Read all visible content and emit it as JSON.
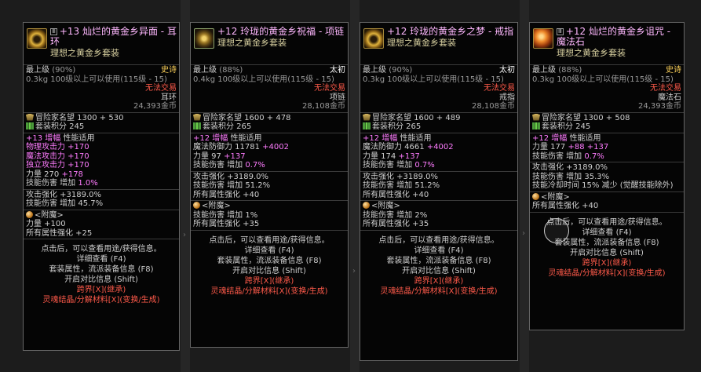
{
  "cards": [
    {
      "title": "灿烂的黄金乡异面 - 耳环",
      "plus": "+13",
      "set": "理想之黄金乡套装",
      "grade_label": "最上级",
      "grade_pct": "(90%)",
      "rarity": "史诗",
      "usage": "0.3kg  100级以上可以使用(115级 - 15)",
      "trade": "无法交易",
      "slot": "耳环",
      "price": "24,393金币",
      "fame": "冒险家名望 1300 + 530",
      "set_points": "套装积分 245",
      "amp_plus": "+13",
      "amp_word": "增幅",
      "amp_rest": " 性能适用",
      "lines_a": [
        {
          "t": "物理攻击力 +170",
          "c": "pink"
        },
        {
          "t": "魔法攻击力 +170",
          "c": "pink"
        },
        {
          "t": "独立攻击力 +170",
          "c": "pink"
        },
        {
          "t": "力量 270 ",
          "c": "",
          "x": "+178",
          "xc": "pink"
        },
        {
          "t": "技能伤害 增加 ",
          "c": "",
          "x": "1.0%",
          "xc": "pink"
        }
      ],
      "lines_b": [
        "攻击强化 +3189.0%",
        "技能伤害 增加 45.7%"
      ],
      "enchant_label": "<附魔>",
      "lines_c": [
        "力量 +100",
        "所有属性强化 +25"
      ]
    },
    {
      "title": "玲珑的黄金乡祝福 - 项链",
      "plus": "+12",
      "set": "理想之黄金乡套装",
      "grade_label": "最上级",
      "grade_pct": "(88%)",
      "rarity": "太初",
      "usage": "0.4kg  100级以上可以使用(115级 - 15)",
      "trade": "无法交易",
      "slot": "项链",
      "price": "28,108金币",
      "fame": "冒险家名望 1600 + 478",
      "set_points": "套装积分 265",
      "amp_plus": "+12",
      "amp_word": "增幅",
      "amp_rest": " 性能适用",
      "lines_a": [
        {
          "t": "魔法防御力 11781 ",
          "c": "",
          "x": "+4002",
          "xc": "pink"
        },
        {
          "t": "力量 97 ",
          "c": "",
          "x": "+137",
          "xc": "pink"
        },
        {
          "t": "技能伤害 增加 ",
          "c": "",
          "x": "0.7%",
          "xc": "pink"
        }
      ],
      "lines_b": [
        "攻击强化 +3189.0%",
        "技能伤害 增加 51.2%",
        "所有属性强化 +40"
      ],
      "enchant_label": "<附魔>",
      "lines_c": [
        "技能伤害 增加 1%",
        "所有属性强化 +35"
      ]
    },
    {
      "title": "玲珑的黄金乡之梦 - 戒指",
      "plus": "+12",
      "set": "理想之黄金乡套装",
      "grade_label": "最上级",
      "grade_pct": "(90%)",
      "rarity": "太初",
      "usage": "0.3kg  100级以上可以使用(115级 - 15)",
      "trade": "无法交易",
      "slot": "戒指",
      "price": "28,108金币",
      "fame": "冒险家名望 1600 + 489",
      "set_points": "套装积分 265",
      "amp_plus": "+12",
      "amp_word": "增幅",
      "amp_rest": " 性能适用",
      "lines_a": [
        {
          "t": "魔法防御力 4661 ",
          "c": "",
          "x": "+4002",
          "xc": "pink"
        },
        {
          "t": "力量 174 ",
          "c": "",
          "x": "+137",
          "xc": "pink"
        },
        {
          "t": "技能伤害 增加 ",
          "c": "",
          "x": "0.7%",
          "xc": "pink"
        }
      ],
      "lines_b": [
        "攻击强化 +3189.0%",
        "技能伤害 增加 51.2%",
        "所有属性强化 +40"
      ],
      "enchant_label": "<附魔>",
      "lines_c": [
        "技能伤害 增加 2%",
        "所有属性强化 +35"
      ]
    },
    {
      "title": "灿烂的黄金乡诅咒 - 魔法石",
      "plus": "+12",
      "set": "理想之黄金乡套装",
      "grade_label": "最上级",
      "grade_pct": "(88%)",
      "rarity": "史诗",
      "usage": "0.3kg  100级以上可以使用(115级 - 15)",
      "trade": "无法交易",
      "slot": "魔法石",
      "price": "24,393金币",
      "fame": "冒险家名望 1300 + 508",
      "set_points": "套装积分 245",
      "amp_plus": "+12",
      "amp_word": "增幅",
      "amp_rest": " 性能适用",
      "lines_a": [
        {
          "t": "力量 177 ",
          "c": "",
          "x": "+88 +137",
          "xc": "pink"
        },
        {
          "t": "技能伤害 增加 ",
          "c": "",
          "x": "0.7%",
          "xc": "pink"
        }
      ],
      "lines_b": [
        "攻击强化 +3189.0%",
        "技能伤害 增加 35.3%",
        "技能冷却时间 15% 减少 (觉醒技能除外)"
      ],
      "enchant_label": "<附魔>",
      "lines_c": [
        "所有属性强化 +40"
      ]
    }
  ],
  "footer": {
    "hint": "点击后，可以查看用途/获得信息。",
    "detail": "详细查看 (F4)",
    "set_attr": "套装属性，流派装备信息 (F8)",
    "compare": "开启对比信息 (Shift)",
    "cross": "跨界[X](继承)",
    "soul": "灵魂结晶/分解材料[X](变换/生成)"
  },
  "colors": {
    "title": "#ffb8ff",
    "epic": "#ffd35a",
    "primal": "#ffffff",
    "red": "#ff5a4a",
    "pink": "#ff7cff"
  }
}
